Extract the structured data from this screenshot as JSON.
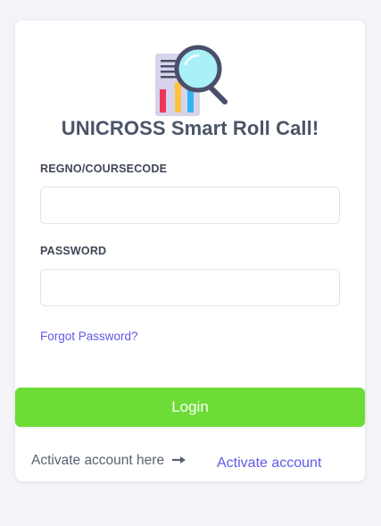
{
  "app": {
    "title": "UNICROSS Smart Roll Call!",
    "logo_icon": "report-magnifier-icon"
  },
  "form": {
    "regno_label": "REGNO/COURSECODE",
    "regno_value": "",
    "password_label": "PASSWORD",
    "password_value": "",
    "forgot_link": "Forgot Password?",
    "login_button": "Login"
  },
  "footer": {
    "activate_hint": "Activate account here",
    "arrow_icon": "arrow-right-icon",
    "activate_link": "Activate account"
  },
  "colors": {
    "page_bg": "#f3f3f8",
    "card_bg": "#ffffff",
    "title": "#4a5568",
    "link": "#6159e8",
    "button": "#6ddc36",
    "button_text": "#ffffff"
  }
}
